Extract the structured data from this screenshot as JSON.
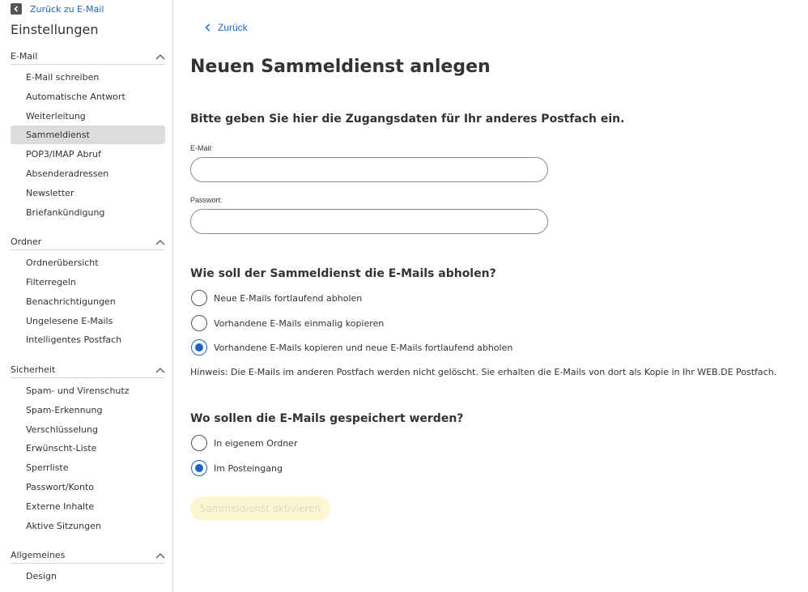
{
  "sidebar": {
    "back_label": "Zurück zu E-Mail",
    "title": "Einstellungen",
    "sections": [
      {
        "label": "E-Mail",
        "items": [
          "E-Mail schreiben",
          "Automatische Antwort",
          "Weiterleitung",
          "Sammeldienst",
          "POP3/IMAP Abruf",
          "Absenderadressen",
          "Newsletter",
          "Briefankündigung"
        ]
      },
      {
        "label": "Ordner",
        "items": [
          "Ordnerübersicht",
          "Filterregeln",
          "Benachrichtigungen",
          "Ungelesene E-Mails",
          "Intelligentes Postfach"
        ]
      },
      {
        "label": "Sicherheit",
        "items": [
          "Spam- und Virenschutz",
          "Spam-Erkennung",
          "Verschlüsselung",
          "Erwünscht-Liste",
          "Sperrliste",
          "Passwort/Konto",
          "Externe Inhalte",
          "Aktive Sitzungen"
        ]
      },
      {
        "label": "Allgemeines",
        "items": [
          "Design"
        ]
      }
    ],
    "active_item": "Sammeldienst"
  },
  "main": {
    "back_label": "Zurück",
    "title": "Neuen Sammeldienst anlegen",
    "credentials_heading": "Bitte geben Sie hier die Zugangsdaten für Ihr anderes Postfach ein.",
    "email_label": "E-Mail:",
    "email_value": "",
    "password_label": "Passwort:",
    "password_value": "",
    "fetch_heading": "Wie soll der Sammeldienst die E-Mails abholen?",
    "fetch_options": [
      {
        "label": "Neue E-Mails fortlaufend abholen",
        "checked": false
      },
      {
        "label": "Vorhandene E-Mails einmalig kopieren",
        "checked": false
      },
      {
        "label": "Vorhandene E-Mails kopieren und neue E-Mails fortlaufend abholen",
        "checked": true
      }
    ],
    "hint": "Hinweis: Die E-Mails im anderen Postfach werden nicht gelöscht. Sie erhalten die E-Mails von dort als Kopie in Ihr WEB.DE Postfach.",
    "store_heading": "Wo sollen die E-Mails gespeichert werden?",
    "store_options": [
      {
        "label": "In eigenem Ordner",
        "checked": false
      },
      {
        "label": "Im Posteingang",
        "checked": true
      }
    ],
    "activate_label": "Sammeldienst aktivieren"
  },
  "colors": {
    "accent": "#1f63c1",
    "active_nav": "#dcdcdc",
    "disabled_button_bg": "#fdf6d3",
    "disabled_button_text": "#e3dcb8"
  }
}
